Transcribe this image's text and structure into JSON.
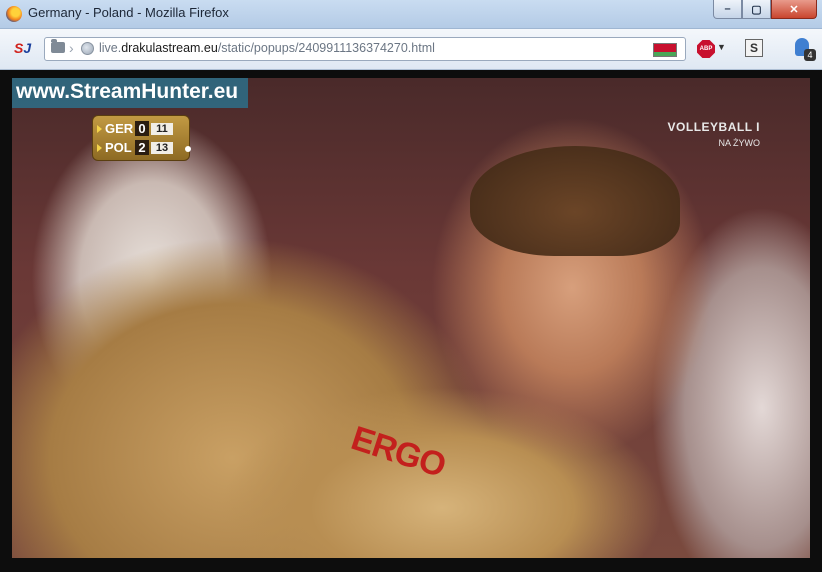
{
  "window": {
    "title": "Germany - Poland - Mozilla Firefox",
    "buttons": {
      "minimize": "–",
      "maximize": "▢",
      "close": "✕"
    }
  },
  "toolbar": {
    "sj_logo": {
      "s": "S",
      "j": "J"
    },
    "url": {
      "prefix": "live.",
      "domain": "drakulastream.eu",
      "path": "/static/popups/2409911136374270.html"
    },
    "abp_label": "ABP",
    "s_label": "S",
    "notification_count": "4"
  },
  "video": {
    "watermark": "www.StreamHunter.eu",
    "scoreboard": {
      "rows": [
        {
          "team": "GER",
          "sets": "0",
          "points": "11",
          "serving": false
        },
        {
          "team": "POL",
          "sets": "2",
          "points": "13",
          "serving": true
        }
      ]
    },
    "channel": {
      "name": "VOLLEYBALL",
      "suffix": "I",
      "live_text": "NA ŻYWO"
    },
    "shirt_text": "ERGO"
  },
  "colors": {
    "accent": "#c8102e",
    "scoreboard": "#a8802f",
    "watermark_bg": "#2878a0"
  }
}
